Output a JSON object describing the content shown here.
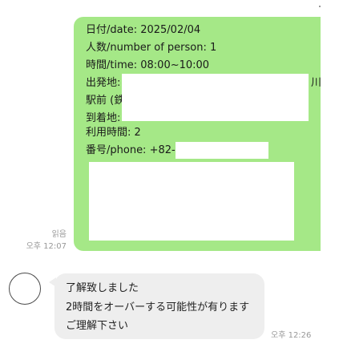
{
  "sent_message": {
    "lines": [
      "日付/date: 2025/02/04",
      "人数/number of person: 1",
      "時間/time: 08:00~10:00",
      "出発地:",
      "駅前 (鉄",
      "到着地:",
      "利用時間:  2",
      "番号/phone: +82-"
    ],
    "departure_suffix": "川",
    "read_status": "읽음",
    "time": "오후 12:07"
  },
  "received_message": {
    "lines": [
      "了解致しました",
      "2時間をオーバーする可能性が有ります",
      "ご理解下さい"
    ],
    "time": "오후 12:26"
  }
}
